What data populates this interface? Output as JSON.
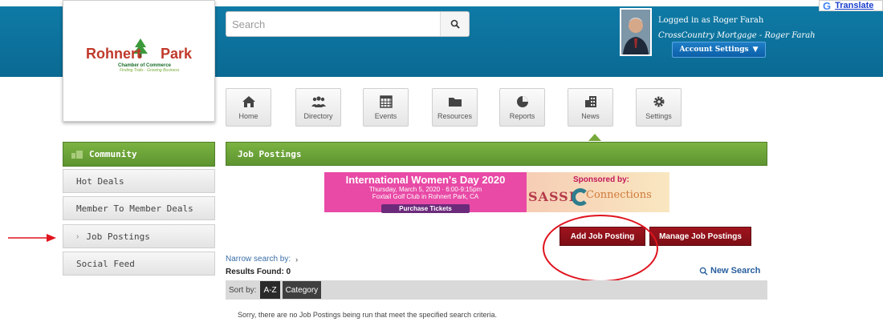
{
  "logo": {
    "name_left": "Rohnert",
    "name_right": "Park",
    "subtitle": "Chamber of Commerce",
    "tagline": "Finding Trails · Growing Business"
  },
  "search": {
    "placeholder": "Search"
  },
  "translate": {
    "g": "G",
    "label": "Translate"
  },
  "user": {
    "line1": "Logged in as Roger Farah",
    "line2": "CrossCountry Mortgage - Roger Farah",
    "account_settings": "Account Settings",
    "caret": "▼"
  },
  "nav": {
    "items": [
      {
        "label": "Home",
        "icon": "home-icon"
      },
      {
        "label": "Directory",
        "icon": "people-icon"
      },
      {
        "label": "Events",
        "icon": "calendar-icon"
      },
      {
        "label": "Resources",
        "icon": "folder-icon"
      },
      {
        "label": "Reports",
        "icon": "pie-chart-icon"
      },
      {
        "label": "News",
        "icon": "building-icon"
      },
      {
        "label": "Settings",
        "icon": "gear-icon"
      }
    ]
  },
  "sidebar": {
    "section": "Community",
    "items": [
      {
        "label": "Hot Deals"
      },
      {
        "label": "Member To Member Deals"
      },
      {
        "label": "Job Postings",
        "chev": "›"
      },
      {
        "label": "Social Feed"
      }
    ]
  },
  "main": {
    "title": "Job Postings",
    "banner": {
      "title": "International Women's Day 2020",
      "line2": "Thursday, March 5, 2020 · 6:00-9:15pm",
      "line3": "Foxtail Golf Club in Rohnert Park, CA",
      "ticket": "Purchase Tickets",
      "sponsored": "Sponsored by:",
      "sassi": "SASSI",
      "connections": "Connections"
    },
    "add_button": "Add Job Posting",
    "manage_button": "Manage Job Postings",
    "narrow": "Narrow search by:",
    "narrow_arrow": "›",
    "results": "Results Found: 0",
    "new_search": "New Search",
    "sort_label": "Sort by:",
    "sort_az": "A-Z",
    "sort_category": "Category",
    "empty_message": "Sorry, there are no Job Postings being run that meet the specified search criteria."
  },
  "colors": {
    "topbar": "#0f7aa6",
    "green": "#6aa537",
    "red_button": "#8e1019",
    "annotation": "#e0141e"
  }
}
